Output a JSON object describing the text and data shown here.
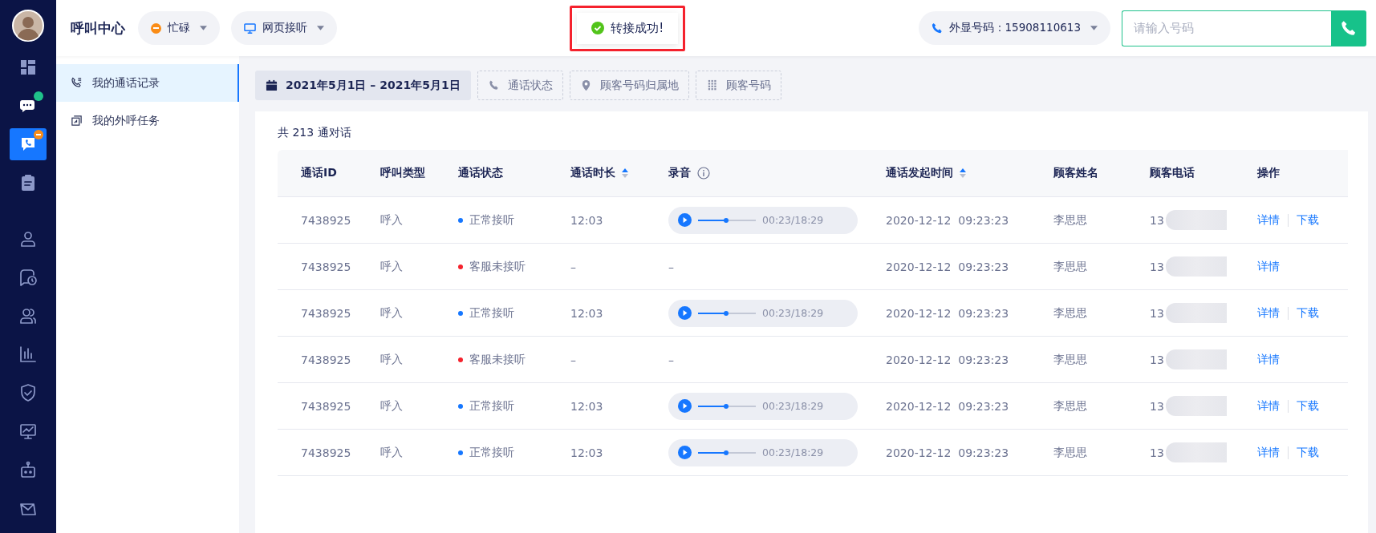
{
  "nav": [
    {
      "selected": false,
      "online_dot": false,
      "busy_badge": false
    },
    {
      "selected": false,
      "online_dot": true,
      "busy_badge": false
    },
    {
      "selected": true,
      "online_dot": false,
      "busy_badge": true
    },
    {
      "selected": false,
      "online_dot": false,
      "busy_badge": false
    },
    {
      "selected": false,
      "online_dot": false,
      "busy_badge": false
    },
    {
      "selected": false,
      "online_dot": false,
      "busy_badge": false
    },
    {
      "selected": false,
      "online_dot": false,
      "busy_badge": false
    },
    {
      "selected": false,
      "online_dot": false,
      "busy_badge": false
    },
    {
      "selected": false,
      "online_dot": false,
      "busy_badge": false
    },
    {
      "selected": false,
      "online_dot": false,
      "busy_badge": false
    },
    {
      "selected": false,
      "online_dot": false,
      "busy_badge": false
    },
    {
      "selected": false,
      "online_dot": false,
      "busy_badge": false
    }
  ],
  "header": {
    "title": "呼叫中心",
    "agent_status": {
      "label": "忙碌",
      "color": "#fa8c16"
    },
    "answer_mode": {
      "label": "网页接听"
    },
    "toast": {
      "text": "转接成功!",
      "highlighted": true
    },
    "caller_id": {
      "label": "外显号码：15908110613"
    },
    "dial": {
      "placeholder": "请输入号码"
    }
  },
  "subnav": [
    {
      "label": "我的通话记录",
      "selected": true
    },
    {
      "label": "我的外呼任务",
      "selected": false
    }
  ],
  "filters": [
    {
      "kind": "date",
      "label": "2021年5月1日 – 2021年5月1日",
      "selected": true
    },
    {
      "kind": "status",
      "label": "通话状态",
      "selected": false
    },
    {
      "kind": "location",
      "label": "顾客号码归属地",
      "selected": false
    },
    {
      "kind": "number",
      "label": "顾客号码",
      "selected": false
    }
  ],
  "total": "共 213 通对话",
  "table": {
    "columns": [
      {
        "label": "通话ID",
        "sortable": false,
        "info": false
      },
      {
        "label": "呼叫类型",
        "sortable": false,
        "info": false
      },
      {
        "label": "通话状态",
        "sortable": false,
        "info": false
      },
      {
        "label": "通话时长",
        "sortable": true,
        "info": false
      },
      {
        "label": "录音",
        "sortable": false,
        "info": true
      },
      {
        "label": "通话发起时间",
        "sortable": true,
        "info": false
      },
      {
        "label": "顾客姓名",
        "sortable": false,
        "info": false
      },
      {
        "label": "顾客电话",
        "sortable": false,
        "info": false
      },
      {
        "label": "操作",
        "sortable": false,
        "info": false
      }
    ],
    "rows": [
      {
        "id": "7438925",
        "type": "呼入",
        "status": "正常接听",
        "color": "#1677ff",
        "duration": "12:03",
        "recording": {
          "kind": "player",
          "time": "00:23/18:29",
          "level": 0.48
        },
        "start": "2020-12-12  09:23:23",
        "name": "李思思",
        "phone": "13",
        "actions": [
          "详情",
          "下载"
        ]
      },
      {
        "id": "7438925",
        "type": "呼入",
        "status": "客服未接听",
        "color": "#f5222d",
        "duration": "–",
        "recording": {
          "kind": "text",
          "text": "–"
        },
        "start": "2020-12-12  09:23:23",
        "name": "李思思",
        "phone": "13",
        "actions": [
          "详情"
        ]
      },
      {
        "id": "7438925",
        "type": "呼入",
        "status": "正常接听",
        "color": "#1677ff",
        "duration": "12:03",
        "recording": {
          "kind": "player",
          "time": "00:23/18:29",
          "level": 0.48
        },
        "start": "2020-12-12  09:23:23",
        "name": "李思思",
        "phone": "13",
        "actions": [
          "详情",
          "下载"
        ]
      },
      {
        "id": "7438925",
        "type": "呼入",
        "status": "客服未接听",
        "color": "#f5222d",
        "duration": "–",
        "recording": {
          "kind": "text",
          "text": "–"
        },
        "start": "2020-12-12  09:23:23",
        "name": "李思思",
        "phone": "13",
        "actions": [
          "详情"
        ]
      },
      {
        "id": "7438925",
        "type": "呼入",
        "status": "正常接听",
        "color": "#1677ff",
        "duration": "12:03",
        "recording": {
          "kind": "player",
          "time": "00:23/18:29",
          "level": 0.48
        },
        "start": "2020-12-12  09:23:23",
        "name": "李思思",
        "phone": "13",
        "actions": [
          "详情",
          "下载"
        ]
      },
      {
        "id": "7438925",
        "type": "呼入",
        "status": "正常接听",
        "color": "#1677ff",
        "duration": "12:03",
        "recording": {
          "kind": "player",
          "time": "00:23/18:29",
          "level": 0.48
        },
        "start": "2020-12-12  09:23:23",
        "name": "李思思",
        "phone": "13",
        "actions": [
          "详情",
          "下载"
        ]
      }
    ]
  }
}
